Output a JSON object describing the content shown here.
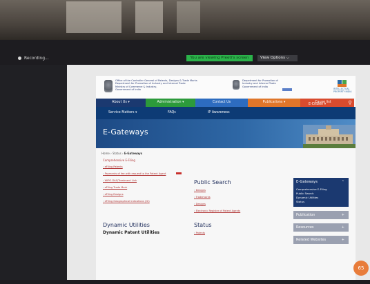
{
  "zoom": {
    "recording_label": "Recording...",
    "viewing_banner": "You are viewing Preeti's screen",
    "view_options_label": "View Options ⌵"
  },
  "header": {
    "left_text_lines": [
      "Office of the Controller General of Patents, Designs & Trade Marks",
      "Department for Promotion of Industry and Internal Trade",
      "Ministry of Commerce & Industry,",
      "Government of India"
    ],
    "right_text_lines": [
      "Department for Promotion of",
      "Industry and Internal Trade",
      "Government of India"
    ],
    "ip_logo_lines": [
      "INTELLECTUAL",
      "PROPERTY INDIA"
    ]
  },
  "nav_primary": [
    {
      "label": "About Us ▾",
      "color": "#1b3970"
    },
    {
      "label": "Administration ▾",
      "color": "#2c9a3b"
    },
    {
      "label": "Contact Us",
      "color": "#2d6cc0"
    },
    {
      "label": "Publications ▾",
      "color": "#e0762a"
    },
    {
      "label": "Cause list",
      "color": "#d94b2e"
    }
  ],
  "nav_secondary": {
    "items": [
      "Service Matters ▾",
      "FAQs",
      "IP Awareness"
    ],
    "e_citizen": "E-Citizen ▾"
  },
  "banner": {
    "title": "E-Gateways"
  },
  "breadcrumb": {
    "home": "Home",
    "sep": "›",
    "status": "Status",
    "current": "E-Gateways"
  },
  "comprehensive_title": "Comprehensive E-Filing",
  "left_links": [
    "eFiling Patents",
    "Payments of fee with request to the Patent Agent",
    "WIPO-DAS/Treatment Link",
    "eFiling Trade Mark",
    "eFiling Designs",
    "eFiling Geographical Indications (GI)"
  ],
  "public_search": {
    "title": "Public Search",
    "links": [
      "Designs",
      "Trademarks",
      "Designs",
      "Electronic Register of Patent Agents"
    ]
  },
  "dynamic": {
    "title": "Dynamic Utilities",
    "subtitle": "Dynamic Patent Utilities"
  },
  "status_section": {
    "title": "Status",
    "links": [
      "Patents"
    ]
  },
  "sidebar": {
    "head": "E-Gateways",
    "chev": "⌃",
    "items": [
      "Comprehensive E-Filing",
      "Public Search",
      "Dynamic Utilities",
      "Status"
    ],
    "boxes": [
      {
        "label": "Publication",
        "sign": "+"
      },
      {
        "label": "Resources",
        "sign": "+"
      },
      {
        "label": "Related Websites",
        "sign": "+"
      }
    ]
  },
  "badge": {
    "value": "65"
  }
}
